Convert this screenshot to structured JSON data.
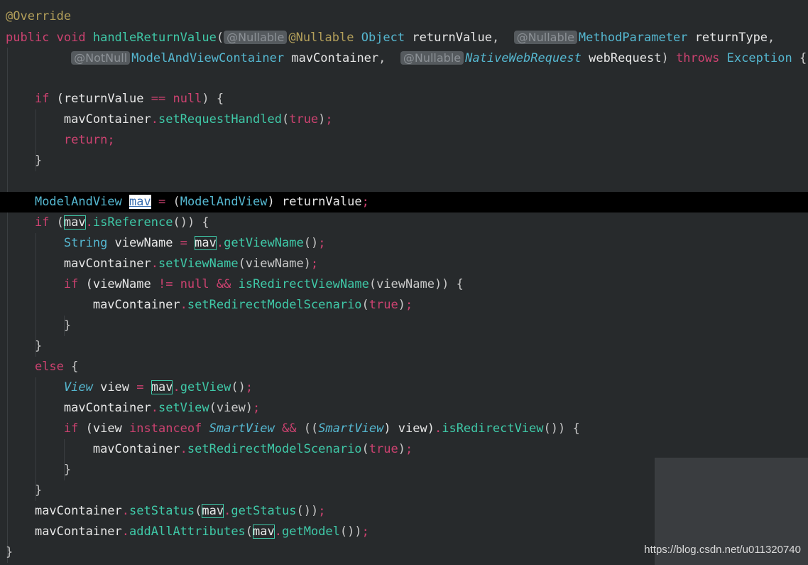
{
  "colors": {
    "background": "#272a2c",
    "current_line": "#000000",
    "annotation": "#b39f5a",
    "keyword": "#cc4270",
    "method": "#3fc9a8",
    "type": "#55b7d0",
    "identifier": "#e6e6e6",
    "inlay_hint_bg": "#555a5e"
  },
  "watermark": "https://blog.csdn.net/u011320740",
  "lines": [
    {
      "tokens": [
        {
          "t": "@Override",
          "c": "anno"
        }
      ]
    },
    {
      "tokens": [
        {
          "t": "public ",
          "c": "kw"
        },
        {
          "t": "void ",
          "c": "kw"
        },
        {
          "t": "handleReturnValue",
          "c": "fn"
        },
        {
          "t": "(",
          "c": "punc"
        },
        {
          "t": "@Nullable",
          "c": "hint"
        },
        {
          "t": "@Nullable ",
          "c": "anno"
        },
        {
          "t": "Object ",
          "c": "type"
        },
        {
          "t": "returnValue",
          "c": "id"
        },
        {
          "t": ",  ",
          "c": "punc"
        },
        {
          "t": "@Nullable",
          "c": "hint"
        },
        {
          "t": "MethodParameter ",
          "c": "type"
        },
        {
          "t": "returnType",
          "c": "id"
        },
        {
          "t": ",",
          "c": "punc"
        }
      ]
    },
    {
      "tokens": [
        {
          "t": "         ",
          "c": "id"
        },
        {
          "t": "@NotNull",
          "c": "hint"
        },
        {
          "t": "ModelAndViewContainer ",
          "c": "type"
        },
        {
          "t": "mavContainer",
          "c": "id"
        },
        {
          "t": ",  ",
          "c": "punc"
        },
        {
          "t": "@Nullable",
          "c": "hint"
        },
        {
          "t": "NativeWebRequest",
          "c": "itype"
        },
        {
          "t": " webRequest",
          "c": "id"
        },
        {
          "t": ") ",
          "c": "punc"
        },
        {
          "t": "throws ",
          "c": "kw"
        },
        {
          "t": "Exception ",
          "c": "type"
        },
        {
          "t": "{",
          "c": "punc"
        }
      ]
    },
    {
      "tokens": []
    },
    {
      "tokens": [
        {
          "t": "    ",
          "c": "id"
        },
        {
          "t": "if ",
          "c": "kw"
        },
        {
          "t": "(returnValue ",
          "c": "id"
        },
        {
          "t": "== ",
          "c": "op"
        },
        {
          "t": "null",
          "c": "kw"
        },
        {
          "t": ") {",
          "c": "punc"
        }
      ]
    },
    {
      "tokens": [
        {
          "t": "        ",
          "c": "id"
        },
        {
          "t": "mavContainer",
          "c": "id"
        },
        {
          "t": ".",
          "c": "op"
        },
        {
          "t": "setRequestHandled",
          "c": "fn"
        },
        {
          "t": "(",
          "c": "punc"
        },
        {
          "t": "true",
          "c": "kw"
        },
        {
          "t": ")",
          "c": "punc"
        },
        {
          "t": ";",
          "c": "semi"
        }
      ]
    },
    {
      "tokens": [
        {
          "t": "        ",
          "c": "id"
        },
        {
          "t": "return",
          "c": "kw"
        },
        {
          "t": ";",
          "c": "semi"
        }
      ]
    },
    {
      "tokens": [
        {
          "t": "    ",
          "c": "id"
        },
        {
          "t": "}",
          "c": "punc"
        }
      ]
    },
    {
      "tokens": []
    },
    {
      "current": true,
      "tokens": [
        {
          "t": "    ",
          "c": "id"
        },
        {
          "t": "ModelAndView ",
          "c": "type"
        },
        {
          "t": "mav",
          "c": "cursor"
        },
        {
          "t": " = ",
          "c": "op"
        },
        {
          "t": "(",
          "c": "punc"
        },
        {
          "t": "ModelAndView",
          "c": "type"
        },
        {
          "t": ") returnValue",
          "c": "id"
        },
        {
          "t": ";",
          "c": "semi"
        }
      ]
    },
    {
      "tokens": [
        {
          "t": "    ",
          "c": "id"
        },
        {
          "t": "if ",
          "c": "kw"
        },
        {
          "t": "(",
          "c": "punc"
        },
        {
          "t": "mav",
          "c": "box"
        },
        {
          "t": ".",
          "c": "op"
        },
        {
          "t": "isReference",
          "c": "fn"
        },
        {
          "t": "()) {",
          "c": "punc"
        }
      ]
    },
    {
      "tokens": [
        {
          "t": "        ",
          "c": "id"
        },
        {
          "t": "String ",
          "c": "type"
        },
        {
          "t": "viewName ",
          "c": "id"
        },
        {
          "t": "= ",
          "c": "op"
        },
        {
          "t": "mav",
          "c": "box"
        },
        {
          "t": ".",
          "c": "op"
        },
        {
          "t": "getViewName",
          "c": "fn"
        },
        {
          "t": "()",
          "c": "punc"
        },
        {
          "t": ";",
          "c": "semi"
        }
      ]
    },
    {
      "tokens": [
        {
          "t": "        ",
          "c": "id"
        },
        {
          "t": "mavContainer",
          "c": "id"
        },
        {
          "t": ".",
          "c": "op"
        },
        {
          "t": "setViewName",
          "c": "fn"
        },
        {
          "t": "(viewName)",
          "c": "punc"
        },
        {
          "t": ";",
          "c": "semi"
        }
      ]
    },
    {
      "tokens": [
        {
          "t": "        ",
          "c": "id"
        },
        {
          "t": "if ",
          "c": "kw"
        },
        {
          "t": "(viewName ",
          "c": "id"
        },
        {
          "t": "!= ",
          "c": "op"
        },
        {
          "t": "null ",
          "c": "kw"
        },
        {
          "t": "&& ",
          "c": "op"
        },
        {
          "t": "isRedirectViewName",
          "c": "fn"
        },
        {
          "t": "(viewName)) {",
          "c": "punc"
        }
      ]
    },
    {
      "tokens": [
        {
          "t": "            ",
          "c": "id"
        },
        {
          "t": "mavContainer",
          "c": "id"
        },
        {
          "t": ".",
          "c": "op"
        },
        {
          "t": "setRedirectModelScenario",
          "c": "fn"
        },
        {
          "t": "(",
          "c": "punc"
        },
        {
          "t": "true",
          "c": "kw"
        },
        {
          "t": ")",
          "c": "punc"
        },
        {
          "t": ";",
          "c": "semi"
        }
      ]
    },
    {
      "tokens": [
        {
          "t": "        ",
          "c": "id"
        },
        {
          "t": "}",
          "c": "punc"
        }
      ]
    },
    {
      "tokens": [
        {
          "t": "    ",
          "c": "id"
        },
        {
          "t": "}",
          "c": "punc"
        }
      ]
    },
    {
      "tokens": [
        {
          "t": "    ",
          "c": "id"
        },
        {
          "t": "else ",
          "c": "kw"
        },
        {
          "t": "{",
          "c": "punc"
        }
      ]
    },
    {
      "tokens": [
        {
          "t": "        ",
          "c": "id"
        },
        {
          "t": "View",
          "c": "itype"
        },
        {
          "t": " view ",
          "c": "id"
        },
        {
          "t": "= ",
          "c": "op"
        },
        {
          "t": "mav",
          "c": "box"
        },
        {
          "t": ".",
          "c": "op"
        },
        {
          "t": "getView",
          "c": "fn"
        },
        {
          "t": "()",
          "c": "punc"
        },
        {
          "t": ";",
          "c": "semi"
        }
      ]
    },
    {
      "tokens": [
        {
          "t": "        ",
          "c": "id"
        },
        {
          "t": "mavContainer",
          "c": "id"
        },
        {
          "t": ".",
          "c": "op"
        },
        {
          "t": "setView",
          "c": "fn"
        },
        {
          "t": "(view)",
          "c": "punc"
        },
        {
          "t": ";",
          "c": "semi"
        }
      ]
    },
    {
      "tokens": [
        {
          "t": "        ",
          "c": "id"
        },
        {
          "t": "if ",
          "c": "kw"
        },
        {
          "t": "(view ",
          "c": "id"
        },
        {
          "t": "instanceof ",
          "c": "kw"
        },
        {
          "t": "SmartView",
          "c": "itype"
        },
        {
          "t": " && ",
          "c": "op"
        },
        {
          "t": "((",
          "c": "punc"
        },
        {
          "t": "SmartView",
          "c": "itype"
        },
        {
          "t": ") view)",
          "c": "id"
        },
        {
          "t": ".",
          "c": "op"
        },
        {
          "t": "isRedirectView",
          "c": "fn"
        },
        {
          "t": "()) {",
          "c": "punc"
        }
      ]
    },
    {
      "tokens": [
        {
          "t": "            ",
          "c": "id"
        },
        {
          "t": "mavContainer",
          "c": "id"
        },
        {
          "t": ".",
          "c": "op"
        },
        {
          "t": "setRedirectModelScenario",
          "c": "fn"
        },
        {
          "t": "(",
          "c": "punc"
        },
        {
          "t": "true",
          "c": "kw"
        },
        {
          "t": ")",
          "c": "punc"
        },
        {
          "t": ";",
          "c": "semi"
        }
      ]
    },
    {
      "tokens": [
        {
          "t": "        ",
          "c": "id"
        },
        {
          "t": "}",
          "c": "punc"
        }
      ]
    },
    {
      "tokens": [
        {
          "t": "    ",
          "c": "id"
        },
        {
          "t": "}",
          "c": "punc"
        }
      ]
    },
    {
      "tokens": [
        {
          "t": "    ",
          "c": "id"
        },
        {
          "t": "mavContainer",
          "c": "id"
        },
        {
          "t": ".",
          "c": "op"
        },
        {
          "t": "setStatus",
          "c": "fn"
        },
        {
          "t": "(",
          "c": "punc"
        },
        {
          "t": "mav",
          "c": "box"
        },
        {
          "t": ".",
          "c": "op"
        },
        {
          "t": "getStatus",
          "c": "fn"
        },
        {
          "t": "())",
          "c": "punc"
        },
        {
          "t": ";",
          "c": "semi"
        }
      ]
    },
    {
      "tokens": [
        {
          "t": "    ",
          "c": "id"
        },
        {
          "t": "mavContainer",
          "c": "id"
        },
        {
          "t": ".",
          "c": "op"
        },
        {
          "t": "addAllAttributes",
          "c": "fn"
        },
        {
          "t": "(",
          "c": "punc"
        },
        {
          "t": "mav",
          "c": "box"
        },
        {
          "t": ".",
          "c": "op"
        },
        {
          "t": "getModel",
          "c": "fn"
        },
        {
          "t": "())",
          "c": "punc"
        },
        {
          "t": ";",
          "c": "semi"
        }
      ]
    },
    {
      "tokens": [
        {
          "t": "}",
          "c": "punc"
        }
      ]
    }
  ]
}
